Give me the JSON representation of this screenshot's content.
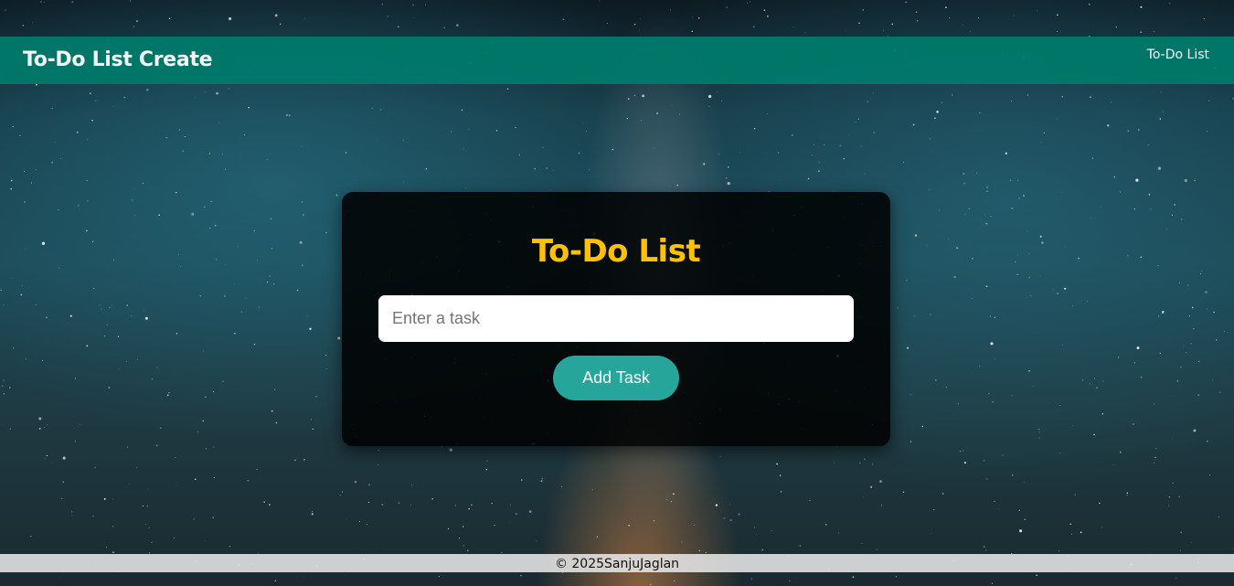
{
  "header": {
    "brand": "To-Do List Create",
    "nav_link": "To-Do List"
  },
  "card": {
    "title": "To-Do List",
    "input_placeholder": "Enter a task",
    "input_value": "",
    "add_button_label": "Add Task"
  },
  "footer": {
    "text": "© 2025SanjuJaglan"
  },
  "colors": {
    "header_bg": "#00796b",
    "title": "#ffc107",
    "button_bg": "#26a69a",
    "card_bg": "rgba(0,0,0,0.86)"
  },
  "background": "starry-night-sky"
}
